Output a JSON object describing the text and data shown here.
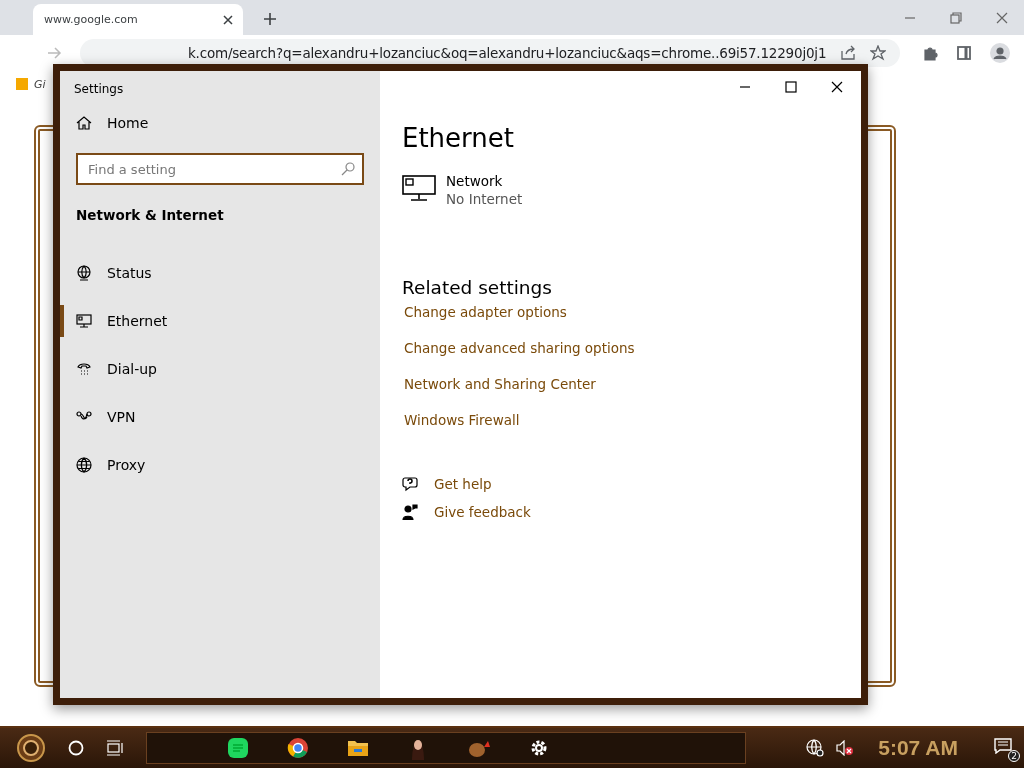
{
  "browser": {
    "tab": {
      "title": "www.google.com"
    },
    "url": "k.com/search?q=alexandru+lozanciuc&oq=alexandru+lozanciuc&aqs=chrome..69i57.12290j0j1",
    "bookmark": "Gi"
  },
  "window": {
    "title": "Settings"
  },
  "sidebar": {
    "home": "Home",
    "search": {
      "placeholder": "Find a setting"
    },
    "section": "Network & Internet",
    "items": [
      {
        "label": "Status",
        "kind": "globe-monitor",
        "selected": false
      },
      {
        "label": "Ethernet",
        "kind": "monitor",
        "selected": true
      },
      {
        "label": "Dial-up",
        "kind": "phone",
        "selected": false
      },
      {
        "label": "VPN",
        "kind": "vpn",
        "selected": false
      },
      {
        "label": "Proxy",
        "kind": "globe",
        "selected": false
      }
    ]
  },
  "content": {
    "title": "Ethernet",
    "network": {
      "name": "Network",
      "status": "No Internet"
    },
    "related_title": "Related settings",
    "links": [
      "Change adapter options",
      "Change advanced sharing options",
      "Network and Sharing Center",
      "Windows Firewall"
    ],
    "help": [
      {
        "label": "Get help",
        "kind": "help"
      },
      {
        "label": "Give feedback",
        "kind": "feedback"
      }
    ]
  },
  "taskbar": {
    "time": "5:07 AM",
    "notifications": "2"
  }
}
